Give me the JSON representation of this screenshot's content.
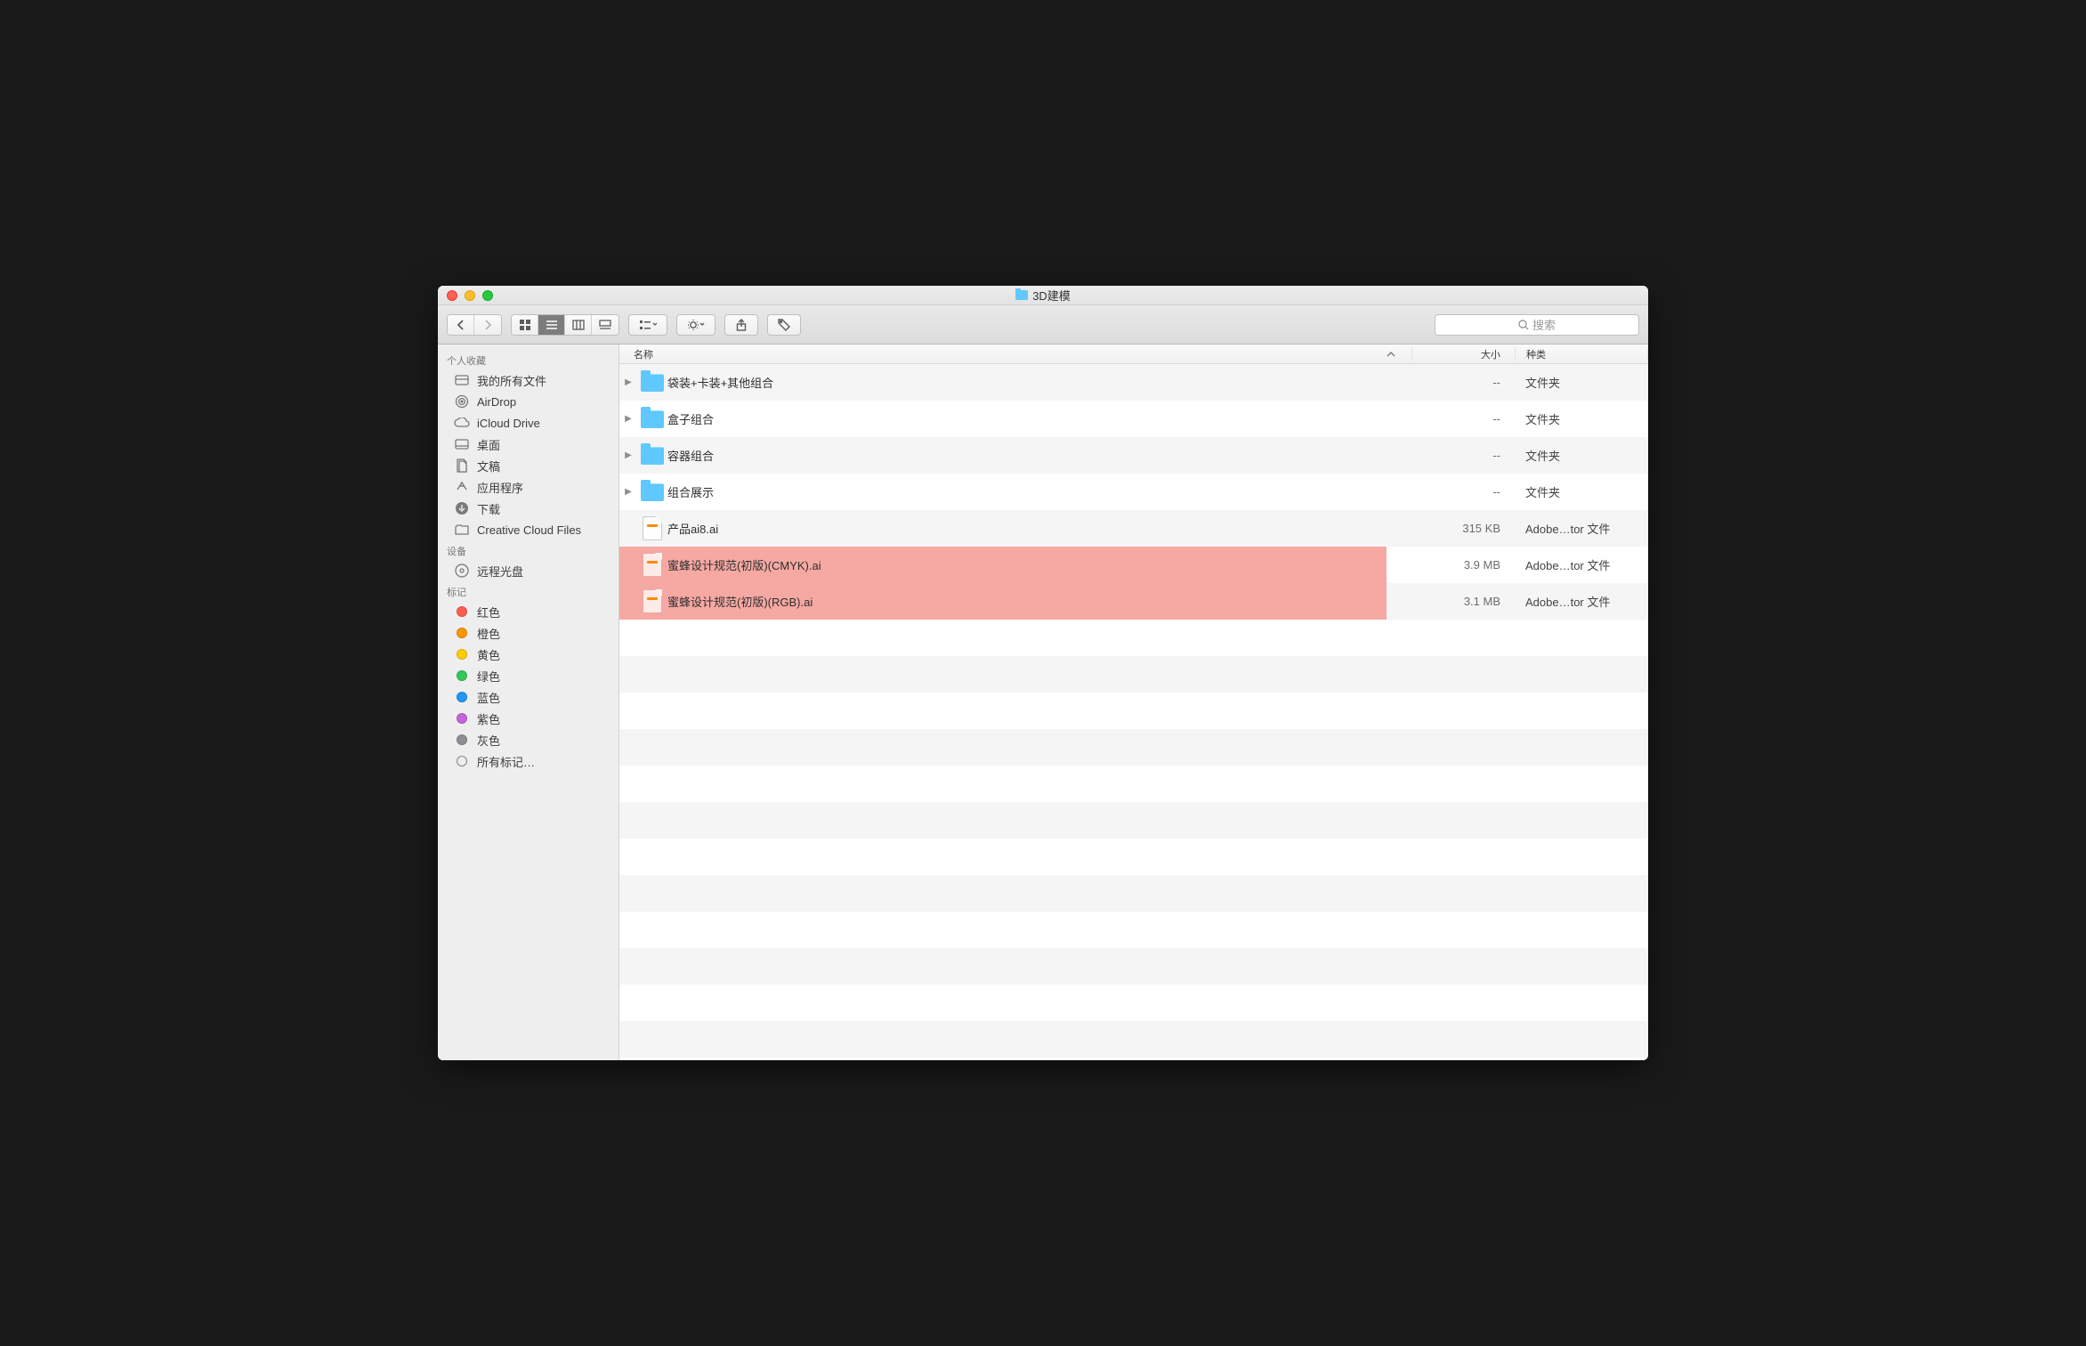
{
  "window": {
    "title": "3D建模"
  },
  "toolbar": {
    "search_placeholder": "搜索"
  },
  "sidebar": {
    "sections": [
      {
        "header": "个人收藏",
        "items": [
          {
            "label": "我的所有文件",
            "icon": "all-files-icon"
          },
          {
            "label": "AirDrop",
            "icon": "airdrop-icon"
          },
          {
            "label": "iCloud Drive",
            "icon": "cloud-icon"
          },
          {
            "label": "桌面",
            "icon": "desktop-icon"
          },
          {
            "label": "文稿",
            "icon": "documents-icon"
          },
          {
            "label": "应用程序",
            "icon": "applications-icon"
          },
          {
            "label": "下载",
            "icon": "downloads-icon"
          },
          {
            "label": "Creative Cloud Files",
            "icon": "folder-icon"
          }
        ]
      },
      {
        "header": "设备",
        "items": [
          {
            "label": "远程光盘",
            "icon": "remote-disc-icon"
          }
        ]
      },
      {
        "header": "标记",
        "items": [
          {
            "label": "红色",
            "color": "#ff5b4f"
          },
          {
            "label": "橙色",
            "color": "#ff9500"
          },
          {
            "label": "黄色",
            "color": "#ffcc00"
          },
          {
            "label": "绿色",
            "color": "#34c759"
          },
          {
            "label": "蓝色",
            "color": "#2196f3"
          },
          {
            "label": "紫色",
            "color": "#c266e0"
          },
          {
            "label": "灰色",
            "color": "#8e8e93"
          },
          {
            "label": "所有标记…",
            "color": null
          }
        ]
      }
    ]
  },
  "columns": {
    "name": "名称",
    "size": "大小",
    "kind": "种类"
  },
  "rows": [
    {
      "type": "folder",
      "name": "袋装+卡装+其他组合",
      "size": "--",
      "kind": "文件夹",
      "highlight": false
    },
    {
      "type": "folder",
      "name": "盒子组合",
      "size": "--",
      "kind": "文件夹",
      "highlight": false
    },
    {
      "type": "folder",
      "name": "容器组合",
      "size": "--",
      "kind": "文件夹",
      "highlight": false
    },
    {
      "type": "folder",
      "name": "组合展示",
      "size": "--",
      "kind": "文件夹",
      "highlight": false
    },
    {
      "type": "file",
      "name": "产品ai8.ai",
      "size": "315 KB",
      "kind": "Adobe…tor 文件",
      "highlight": false
    },
    {
      "type": "file",
      "name": "蜜蜂设计规范(初版)(CMYK).ai",
      "size": "3.9 MB",
      "kind": "Adobe…tor 文件",
      "highlight": true
    },
    {
      "type": "file",
      "name": "蜜蜂设计规范(初版)(RGB).ai",
      "size": "3.1 MB",
      "kind": "Adobe…tor 文件",
      "highlight": true
    }
  ]
}
